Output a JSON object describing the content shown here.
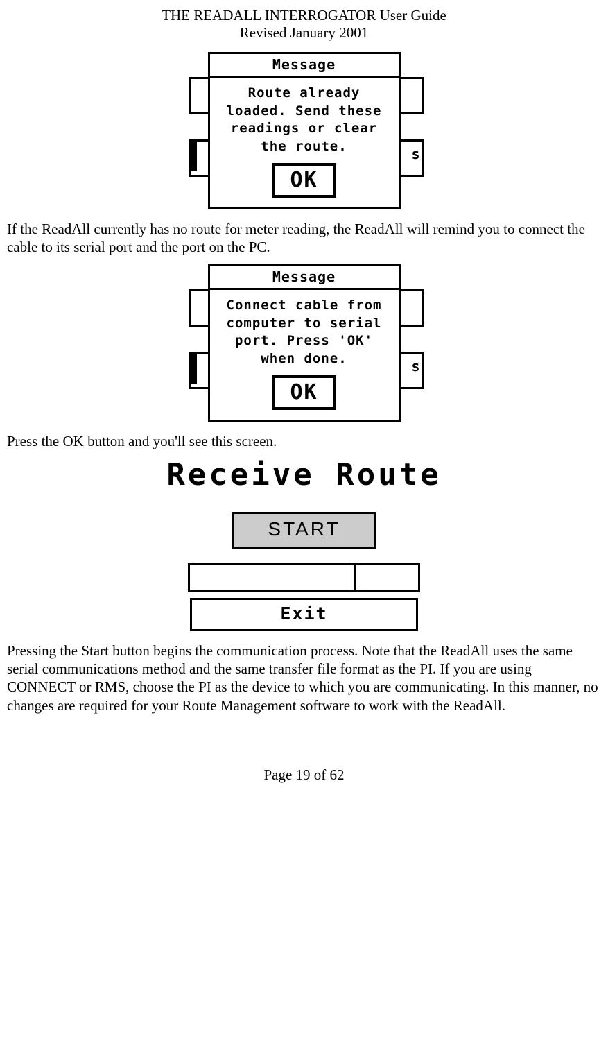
{
  "header": {
    "title": "THE READALL INTERROGATOR User Guide",
    "subtitle": "Revised January 2001"
  },
  "dialog1": {
    "title": "Message",
    "body": "Route already loaded. Send these readings or clear the route.",
    "ok": "OK",
    "behind_char": "s"
  },
  "para1": "If the ReadAll currently has no route for meter reading, the ReadAll will remind you to connect the cable to its serial port and the port on the PC.",
  "dialog2": {
    "title": "Message",
    "body": "Connect cable from computer to serial port. Press 'OK' when done.",
    "ok": "OK",
    "behind_char": "s"
  },
  "para2": "Press the OK button and you'll see this screen.",
  "receive": {
    "title": "Receive Route",
    "start": "START",
    "exit": "Exit"
  },
  "para3": "Pressing the Start button begins the communication process.  Note that the ReadAll uses the same serial communications method and the same transfer file format as the PI.  If you are using CONNECT or RMS, choose the PI as the device to which you are communicating.  In this manner, no changes are required for your Route Management software to work with the ReadAll.",
  "footer": "Page 19 of 62"
}
